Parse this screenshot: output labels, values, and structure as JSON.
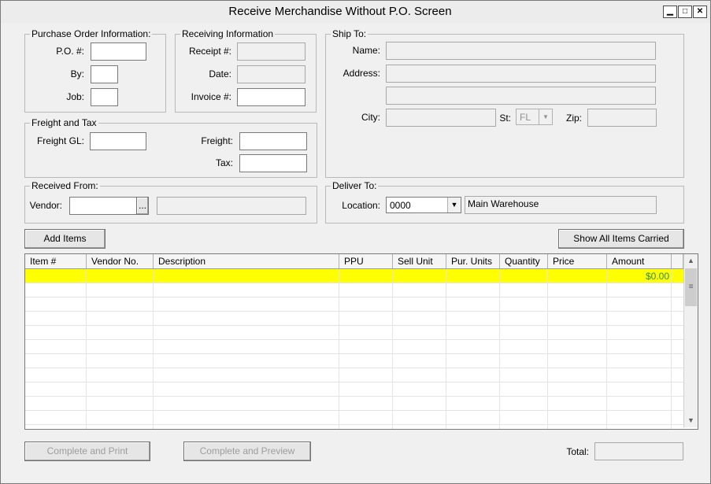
{
  "window": {
    "title": "Receive Merchandise Without P.O. Screen",
    "minimize": "▁",
    "maximize": "□",
    "close": "✕"
  },
  "po_info": {
    "title": "Purchase Order Information:",
    "po_label": "P.O. #:",
    "po_value": "",
    "by_label": "By:",
    "by_value": "",
    "job_label": "Job:",
    "job_value": ""
  },
  "receiving": {
    "title": "Receiving Information",
    "receipt_label": "Receipt #:",
    "receipt_value": "",
    "date_label": "Date:",
    "date_value": "",
    "invoice_label": "Invoice #:",
    "invoice_value": ""
  },
  "ship_to": {
    "title": "Ship To:",
    "name_label": "Name:",
    "name_value": "",
    "address_label": "Address:",
    "address1": "",
    "address2": "",
    "city_label": "City:",
    "city_value": "",
    "state_label": "St:",
    "state_value": "FL",
    "zip_label": "Zip:",
    "zip_value": ""
  },
  "freight_tax": {
    "title": "Freight and Tax",
    "freight_gl_label": "Freight GL:",
    "freight_gl_value": "",
    "freight_label": "Freight:",
    "freight_value": "",
    "tax_label": "Tax:",
    "tax_value": ""
  },
  "received_from": {
    "title": "Received From:",
    "vendor_label": "Vendor:",
    "vendor_value": "",
    "browse_label": "...",
    "vendor_name": ""
  },
  "deliver_to": {
    "title": "Deliver To:",
    "location_label": "Location:",
    "location_value": "0000",
    "location_name": "Main Warehouse"
  },
  "buttons": {
    "add_items": "Add Items",
    "show_all": "Show All Items Carried",
    "complete_print": "Complete and Print",
    "complete_preview": "Complete and Preview"
  },
  "grid": {
    "columns": [
      "Item #",
      "Vendor No.",
      "Description",
      "PPU",
      "Sell Unit",
      "Pur. Units",
      "Quantity",
      "Price",
      "Amount"
    ],
    "first_row_amount": "$0.00",
    "highlight_color": "#ffff00",
    "amount_color": "#2e8b57"
  },
  "total": {
    "label": "Total:",
    "value": ""
  }
}
